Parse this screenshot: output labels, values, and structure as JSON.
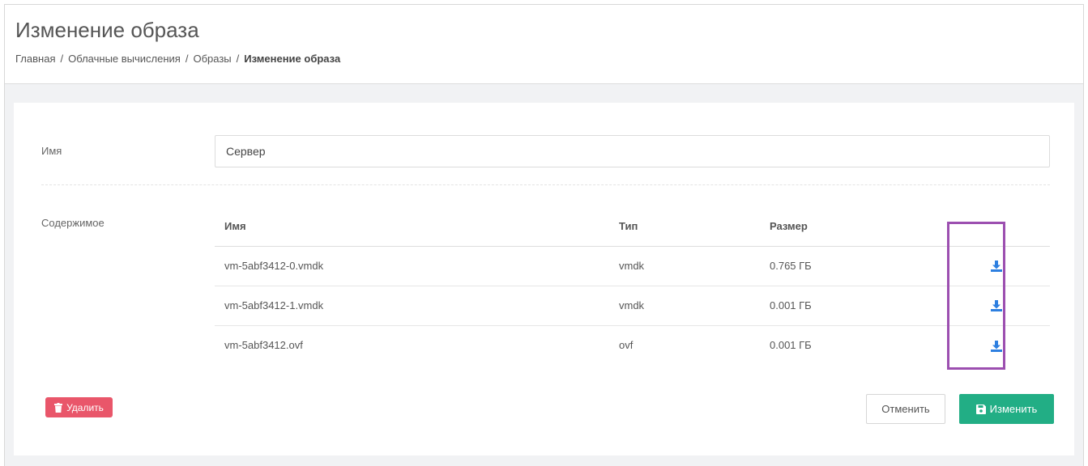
{
  "header": {
    "title": "Изменение образа",
    "breadcrumb": [
      "Главная",
      "Облачные вычисления",
      "Образы",
      "Изменение образа"
    ],
    "separator": "/"
  },
  "form": {
    "name_label": "Имя",
    "name_value": "Сервер",
    "contents_label": "Содержимое"
  },
  "table": {
    "columns": [
      "Имя",
      "Тип",
      "Размер"
    ],
    "rows": [
      {
        "name": "vm-5abf3412-0.vmdk",
        "type": "vmdk",
        "size": "0.765 ГБ"
      },
      {
        "name": "vm-5abf3412-1.vmdk",
        "type": "vmdk",
        "size": "0.001 ГБ"
      },
      {
        "name": "vm-5abf3412.ovf",
        "type": "ovf",
        "size": "0.001 ГБ"
      }
    ],
    "row_action_icon": "download-icon"
  },
  "buttons": {
    "delete_label": "Удалить",
    "cancel_label": "Отменить",
    "save_label": "Изменить"
  },
  "colors": {
    "accent_blue": "#2d7fe0",
    "highlight": "#9c4fb0",
    "delete": "#e9566a",
    "save": "#22ae85"
  }
}
